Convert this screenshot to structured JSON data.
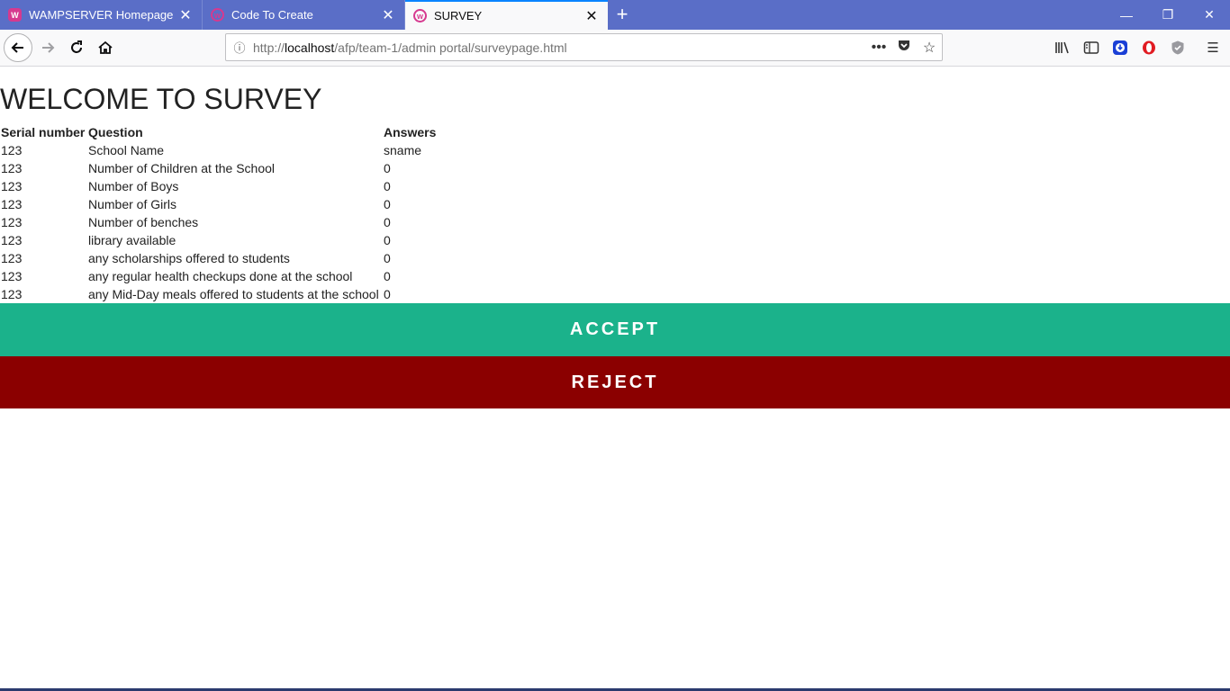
{
  "browser": {
    "tabs": [
      {
        "title": "WAMPSERVER Homepage",
        "active": false,
        "favicon": "wamp-icon"
      },
      {
        "title": "Code To Create",
        "active": false,
        "favicon": "wamp-icon"
      },
      {
        "title": "SURVEY",
        "active": true,
        "favicon": "wamp-icon"
      }
    ],
    "url": {
      "scheme": "http://",
      "host": "localhost",
      "path": "/afp/team-1/admin portal/surveypage.html"
    },
    "colors": {
      "tabstrip": "#5a6ec7",
      "active_tab_accent": "#0a84ff"
    }
  },
  "page": {
    "title": "WELCOME TO SURVEY",
    "table": {
      "headers": [
        "Serial number",
        "Question",
        "Answers"
      ],
      "rows": [
        [
          "123",
          "School Name",
          "sname"
        ],
        [
          "123",
          "Number of Children at the School",
          "0"
        ],
        [
          "123",
          "Number of Boys",
          "0"
        ],
        [
          "123",
          "Number of Girls",
          "0"
        ],
        [
          "123",
          "Number of benches",
          "0"
        ],
        [
          "123",
          "library available",
          "0"
        ],
        [
          "123",
          "any scholarships offered to students",
          "0"
        ],
        [
          "123",
          "any regular health checkups done at the school",
          "0"
        ],
        [
          "123",
          "any Mid-Day meals offered to students at the school",
          "0"
        ]
      ]
    },
    "buttons": {
      "accept_label": "ACCEPT",
      "reject_label": "REJECT",
      "accept_color": "#1bb28b",
      "reject_color": "#8b0000"
    }
  }
}
